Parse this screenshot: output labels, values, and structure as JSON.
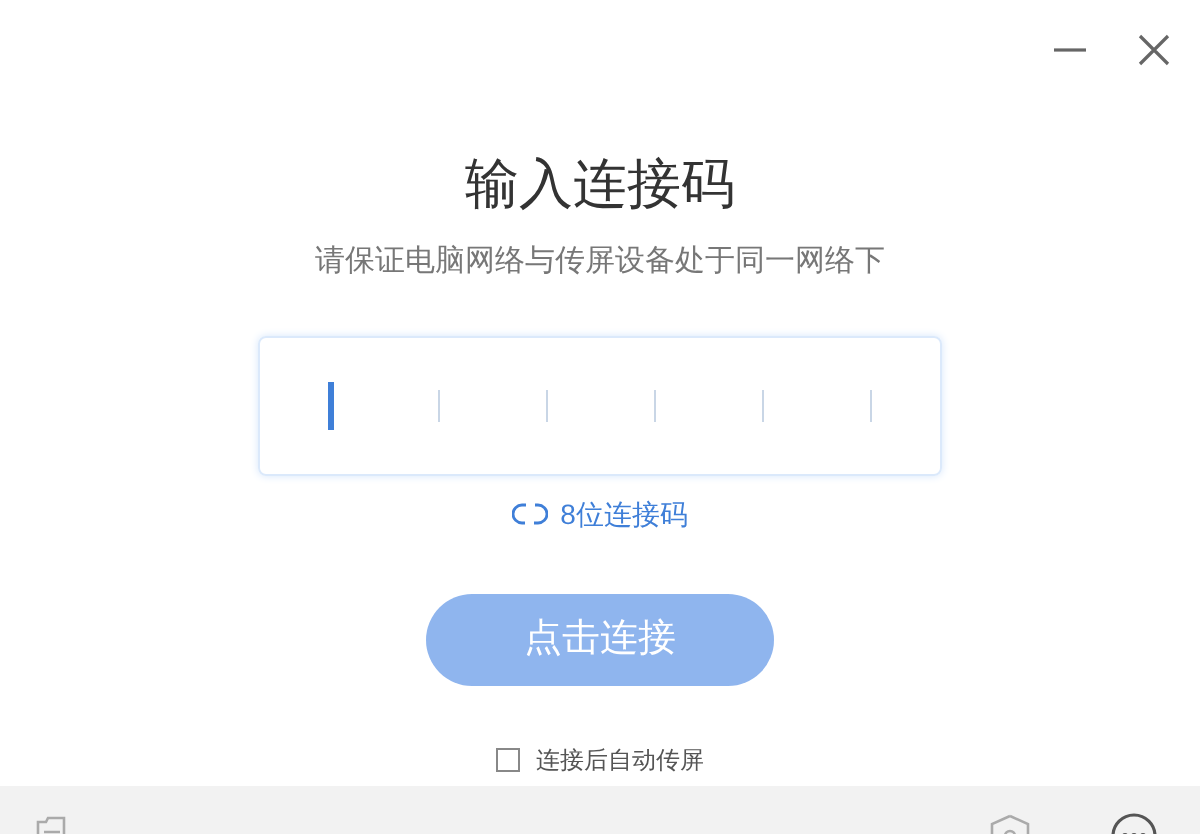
{
  "title": "输入连接码",
  "subtitle": "请保证电脑网络与传屏设备处于同一网络下",
  "code_slots": [
    {
      "selected": true
    },
    {
      "selected": false
    },
    {
      "selected": false
    },
    {
      "selected": false
    },
    {
      "selected": false
    },
    {
      "selected": false
    }
  ],
  "switch_link": "8位连接码",
  "connect_button": {
    "label": "点击连接",
    "disabled": true
  },
  "auto_cast": {
    "label": "连接后自动传屏",
    "checked": false
  }
}
